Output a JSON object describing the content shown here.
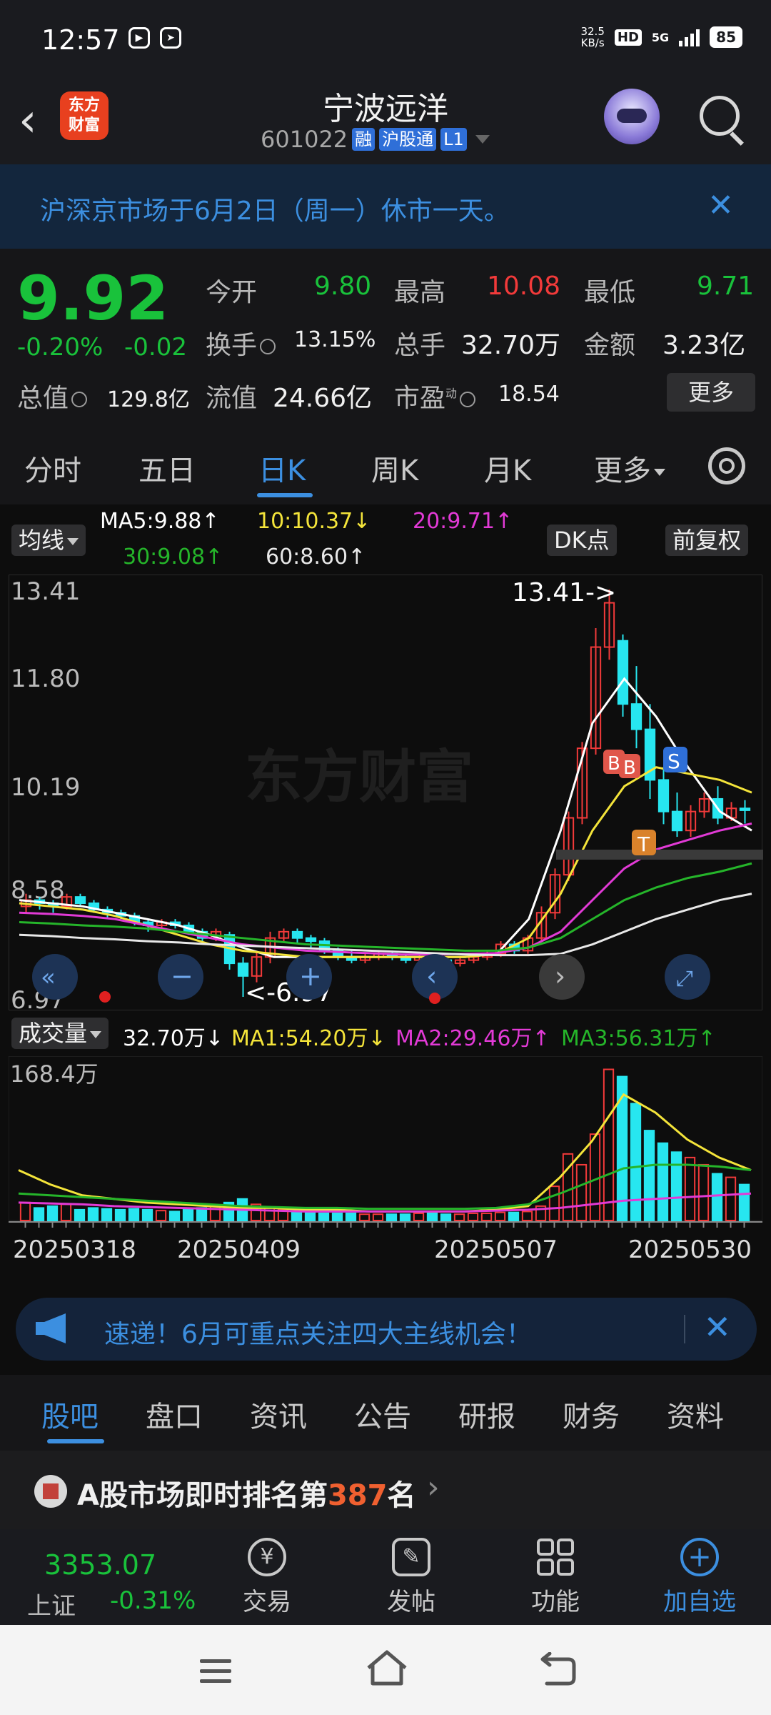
{
  "status": {
    "time": "12:57",
    "net_speed_top": "32.5",
    "net_speed_bottom": "KB/s",
    "hd": "HD",
    "signal": "5G",
    "battery": "85"
  },
  "header": {
    "logo_line1": "东方",
    "logo_line2": "财富",
    "name": "宁波远洋",
    "code": "601022",
    "tags": [
      "融",
      "沪股通",
      "L1"
    ]
  },
  "notice": {
    "text": "沪深京市场于6月2日（周一）休市一天。"
  },
  "quote": {
    "price": "9.92",
    "change_pct": "-0.20%",
    "change": "-0.02",
    "open_label": "今开",
    "open": "9.80",
    "high_label": "最高",
    "high": "10.08",
    "low_label": "最低",
    "low": "9.71",
    "turnover_label": "换手",
    "turnover": "13.15%",
    "volume_label": "总手",
    "volume": "32.70万",
    "amount_label": "金额",
    "amount": "3.23亿",
    "mktcap_label": "总值",
    "mktcap": "129.8亿",
    "float_label": "流值",
    "float": "24.66亿",
    "pe_label": "市盈",
    "pe_sup": "动",
    "pe": "18.54",
    "more": "更多"
  },
  "period_tabs": [
    "分时",
    "五日",
    "日K",
    "周K",
    "月K",
    "更多"
  ],
  "ma": {
    "chip": "均线",
    "ma5": "MA5:9.88↑",
    "ma10": "10:10.37↓",
    "ma20": "20:9.71↑",
    "ma30": "30:9.08↑",
    "ma60": "60:8.60↑",
    "dk": "DK点",
    "adjust": "前复权"
  },
  "kline": {
    "y_labels": [
      "13.41",
      "11.80",
      "10.19",
      "8.58",
      "6.97"
    ],
    "max_label": "13.41->",
    "min_label": "<-6.97",
    "watermark": "东方财富",
    "markers": {
      "b": "B",
      "s": "S",
      "t": "T"
    }
  },
  "volume": {
    "chip": "成交量",
    "vol": "32.70万↓",
    "ma1": "MA1:54.20万↓",
    "ma2": "MA2:29.46万↑",
    "ma3": "MA3:56.31万↑",
    "max": "168.4万",
    "dates": [
      "20250318",
      "20250409",
      "20250507",
      "20250530"
    ]
  },
  "ticker": {
    "text": "速递！6月可重点关注四大主线机会！"
  },
  "bottom_tabs": [
    "股吧",
    "盘口",
    "资讯",
    "公告",
    "研报",
    "财务",
    "资料"
  ],
  "rank": {
    "prefix": "A股市场即时排名第",
    "num": "387",
    "suffix": "名"
  },
  "index": {
    "value": "3353.07",
    "name": "上证",
    "change": "-0.31%"
  },
  "nav": [
    "交易",
    "发帖",
    "功能",
    "加自选"
  ],
  "colors": {
    "up": "#f23a3a",
    "down": "#19c23b",
    "accent": "#3c8fe0",
    "ma5": "#ffffff",
    "ma10": "#f4e43a",
    "ma20": "#e23ad6",
    "ma30": "#25b52a",
    "ma60": "#e8e8e8",
    "candle_down": "#27e6f0"
  }
}
